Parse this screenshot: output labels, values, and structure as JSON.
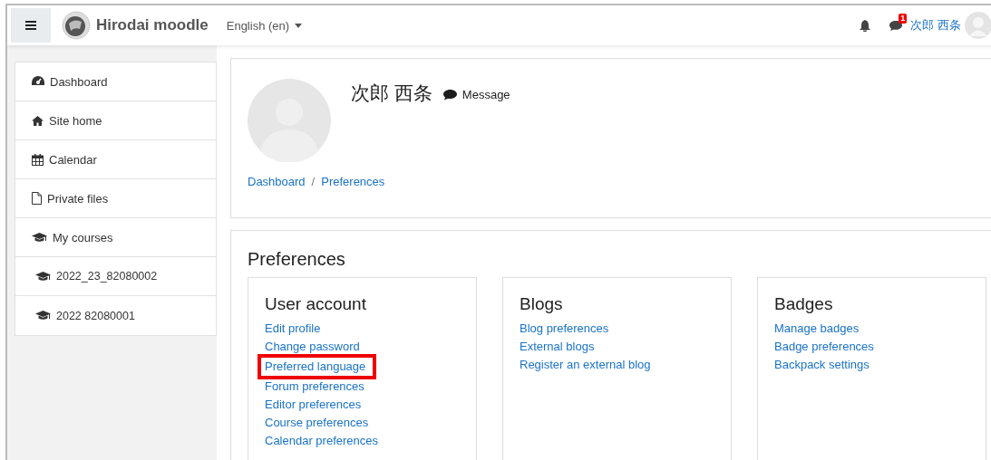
{
  "navbar": {
    "site_name": "Hirodai moodle",
    "language": "English (en)",
    "notification_count": "1",
    "user_name": "次郎 西条"
  },
  "sidebar": {
    "items": [
      {
        "label": "Dashboard",
        "kind": "dashboard",
        "indented": false
      },
      {
        "label": "Site home",
        "kind": "home",
        "indented": false
      },
      {
        "label": "Calendar",
        "kind": "calendar",
        "indented": false
      },
      {
        "label": "Private files",
        "kind": "file",
        "indented": false
      },
      {
        "label": "My courses",
        "kind": "course",
        "indented": false
      },
      {
        "label": "2022_23_82080002",
        "kind": "course",
        "indented": true
      },
      {
        "label": "2022 82080001",
        "kind": "course",
        "indented": true
      }
    ]
  },
  "profile": {
    "name": "次郎 西条",
    "message": "Message"
  },
  "breadcrumb": {
    "separator": "/",
    "links": [
      "Dashboard",
      "Preferences"
    ]
  },
  "preferences": {
    "title": "Preferences",
    "sections": [
      {
        "title": "User account",
        "links": [
          {
            "label": "Edit profile",
            "highlighted": false
          },
          {
            "label": "Change password",
            "highlighted": false
          },
          {
            "label": "Preferred language",
            "highlighted": true
          },
          {
            "label": "Forum preferences",
            "highlighted": false
          },
          {
            "label": "Editor preferences",
            "highlighted": false
          },
          {
            "label": "Course preferences",
            "highlighted": false
          },
          {
            "label": "Calendar preferences",
            "highlighted": false
          }
        ]
      },
      {
        "title": "Blogs",
        "links": [
          {
            "label": "Blog preferences",
            "highlighted": false
          },
          {
            "label": "External blogs",
            "highlighted": false
          },
          {
            "label": "Register an external blog",
            "highlighted": false
          }
        ]
      },
      {
        "title": "Badges",
        "links": [
          {
            "label": "Manage badges",
            "highlighted": false
          },
          {
            "label": "Badge preferences",
            "highlighted": false
          },
          {
            "label": "Backpack settings",
            "highlighted": false
          }
        ]
      }
    ]
  }
}
